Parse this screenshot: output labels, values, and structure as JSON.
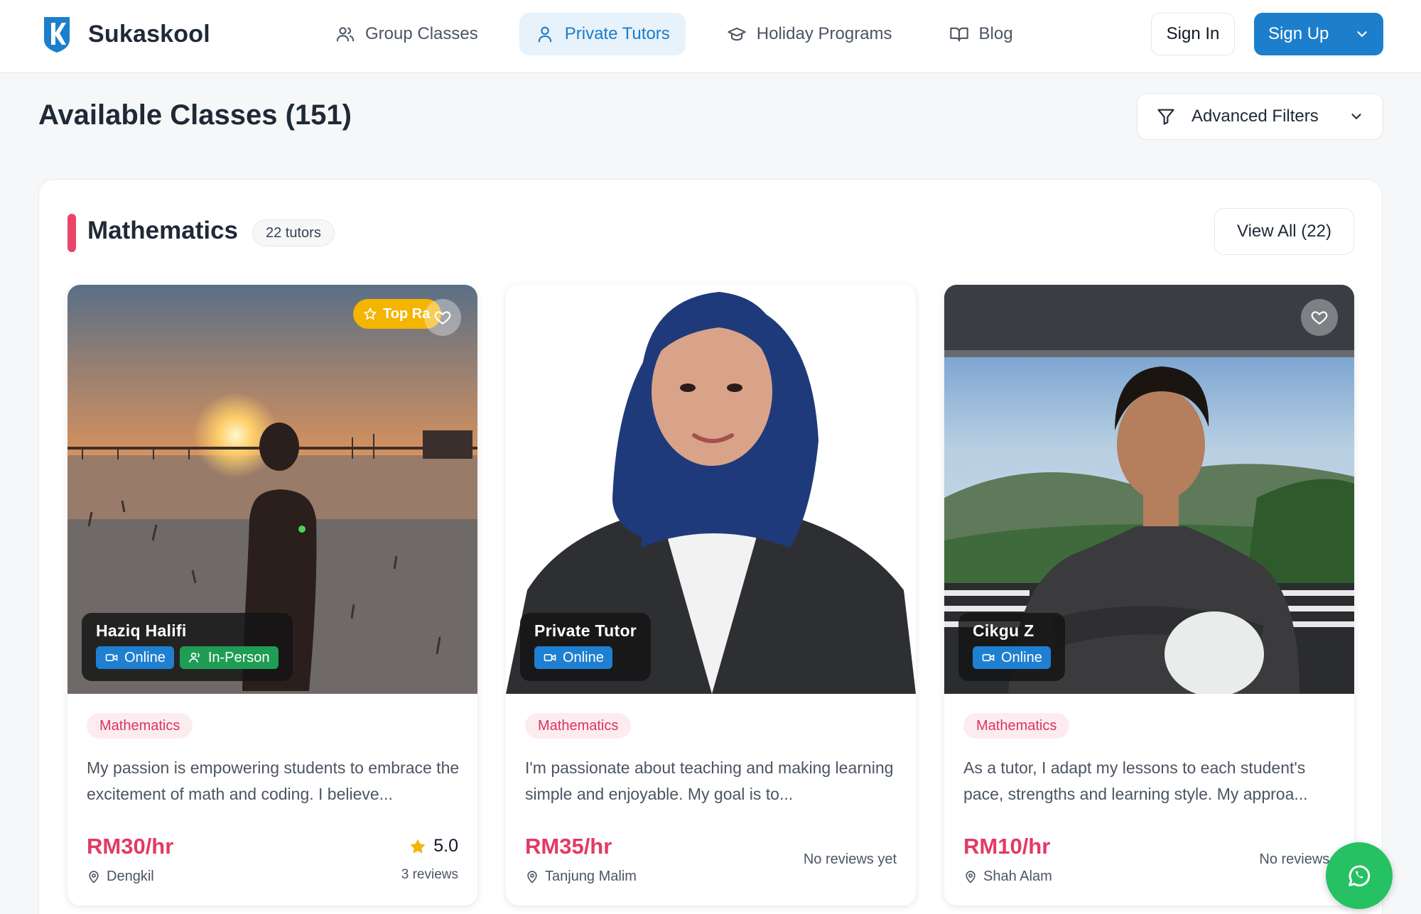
{
  "brand": {
    "name": "Sukaskool"
  },
  "nav": {
    "items": [
      {
        "label": "Group Classes",
        "icon": "users-icon",
        "active": false
      },
      {
        "label": "Private Tutors",
        "icon": "user-icon",
        "active": true
      },
      {
        "label": "Holiday Programs",
        "icon": "graduation-cap-icon",
        "active": false
      },
      {
        "label": "Blog",
        "icon": "book-open-icon",
        "active": false
      }
    ],
    "sign_in": "Sign In",
    "sign_up": "Sign Up"
  },
  "page": {
    "title": "Available Classes (151)",
    "filters_label": "Advanced Filters"
  },
  "section": {
    "title": "Mathematics",
    "count_label": "22 tutors",
    "view_all": "View All (22)",
    "accent_color": "#e8456b"
  },
  "tutors": [
    {
      "name": "Haziq Halifi",
      "badge": "Top Ra",
      "modes": [
        "Online",
        "In-Person"
      ],
      "subject": "Mathematics",
      "bio": "My passion is empowering students to embrace the excitement of math and coding. I believe...",
      "price": "RM30/hr",
      "location": "Dengkil",
      "rating": "5.0",
      "reviews": "3 reviews"
    },
    {
      "name": "Private Tutor",
      "modes": [
        "Online"
      ],
      "subject": "Mathematics",
      "bio": "I'm passionate about teaching and making learning simple and enjoyable. My goal is to...",
      "price": "RM35/hr",
      "location": "Tanjung Malim",
      "reviews_text": "No reviews yet"
    },
    {
      "name": "Cikgu Z",
      "modes": [
        "Online"
      ],
      "subject": "Mathematics",
      "bio": "As a tutor, I adapt my lessons to each student's pace, strengths and learning style. My approa...",
      "price": "RM10/hr",
      "location": "Shah Alam",
      "reviews_text": "No reviews ye"
    }
  ],
  "colors": {
    "primary": "#1d7fcb",
    "price": "#e23a64",
    "online": "#1f7fd1",
    "in_person": "#1f9d55",
    "top_rated": "#f4b400",
    "whatsapp": "#25c163"
  },
  "icons": {
    "whatsapp": "whatsapp-icon",
    "favorite": "heart-icon",
    "location": "map-pin-icon",
    "star": "star-icon",
    "filter": "filter-icon"
  }
}
